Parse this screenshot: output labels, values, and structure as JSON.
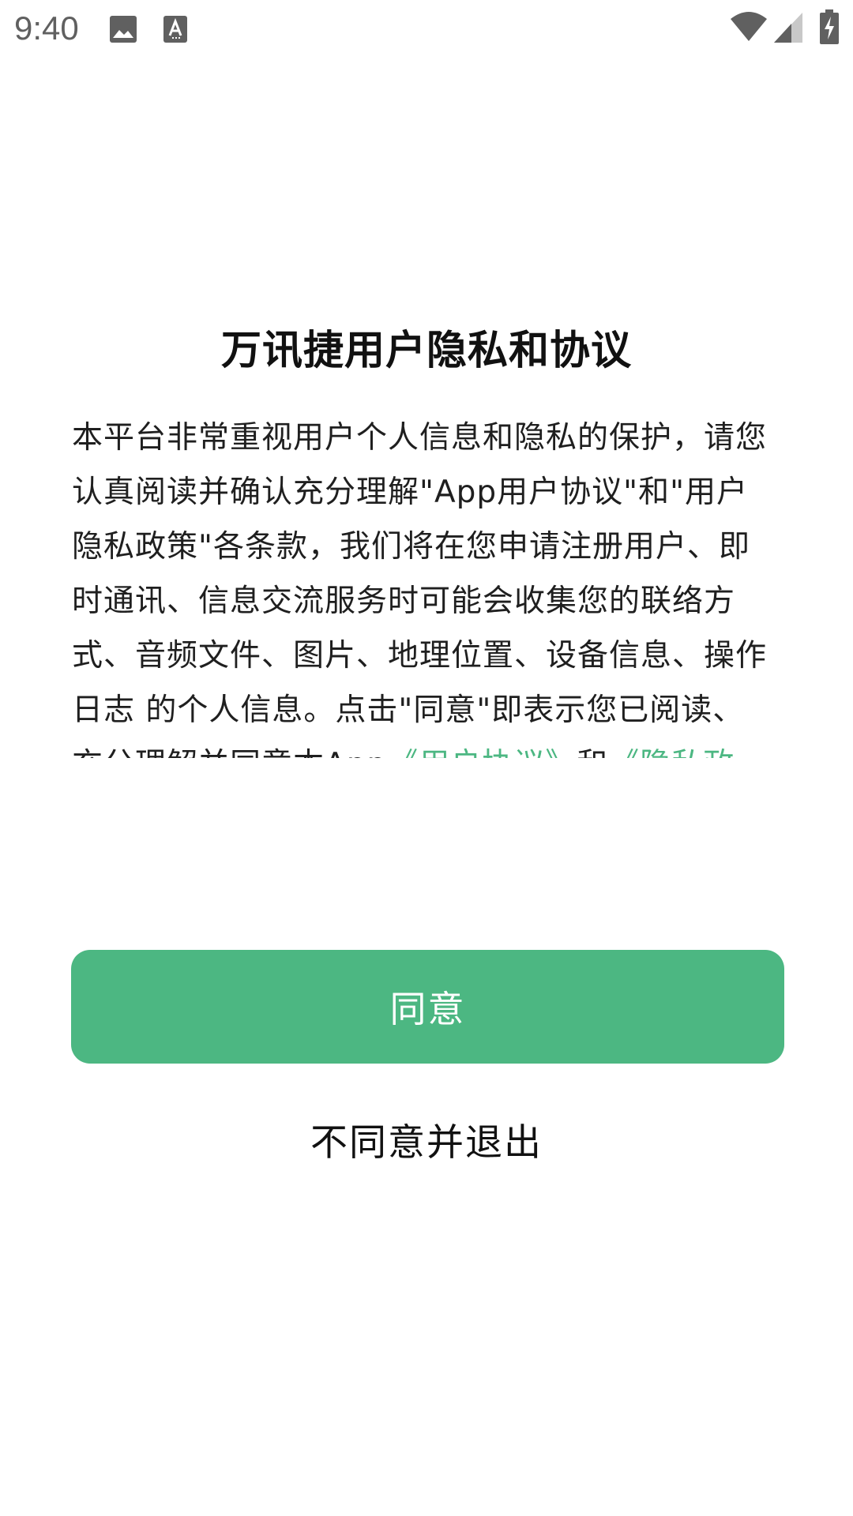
{
  "status_bar": {
    "time": "9:40",
    "left_icons": [
      "image-icon",
      "text-accessibility-icon"
    ],
    "right_icons": [
      "wifi-icon",
      "signal-icon",
      "battery-charging-icon"
    ]
  },
  "dialog": {
    "title": "万讯捷用户隐私和协议",
    "body_part1": "本平台非常重视用户个人信息和隐私的保护，请您认真阅读并确认充分理解\"App用户协议\"和\"用户隐私政策\"各条款，我们将在您申请注册用户、即时通讯、信息交流服务时可能会收集您的联络方式、音频文件、图片、地理位置、设备信息、操作日志 的个人信息。点击\"同意\"即表示您已阅读、充分理解并同意本App",
    "link_user_agreement": "《用户协议》",
    "body_and": "和",
    "link_privacy": "《隐私政策》",
    "agree_label": "同意",
    "disagree_label": "不同意并退出"
  },
  "colors": {
    "accent": "#4cb782",
    "text": "#1f1f1f",
    "background": "#ffffff"
  }
}
